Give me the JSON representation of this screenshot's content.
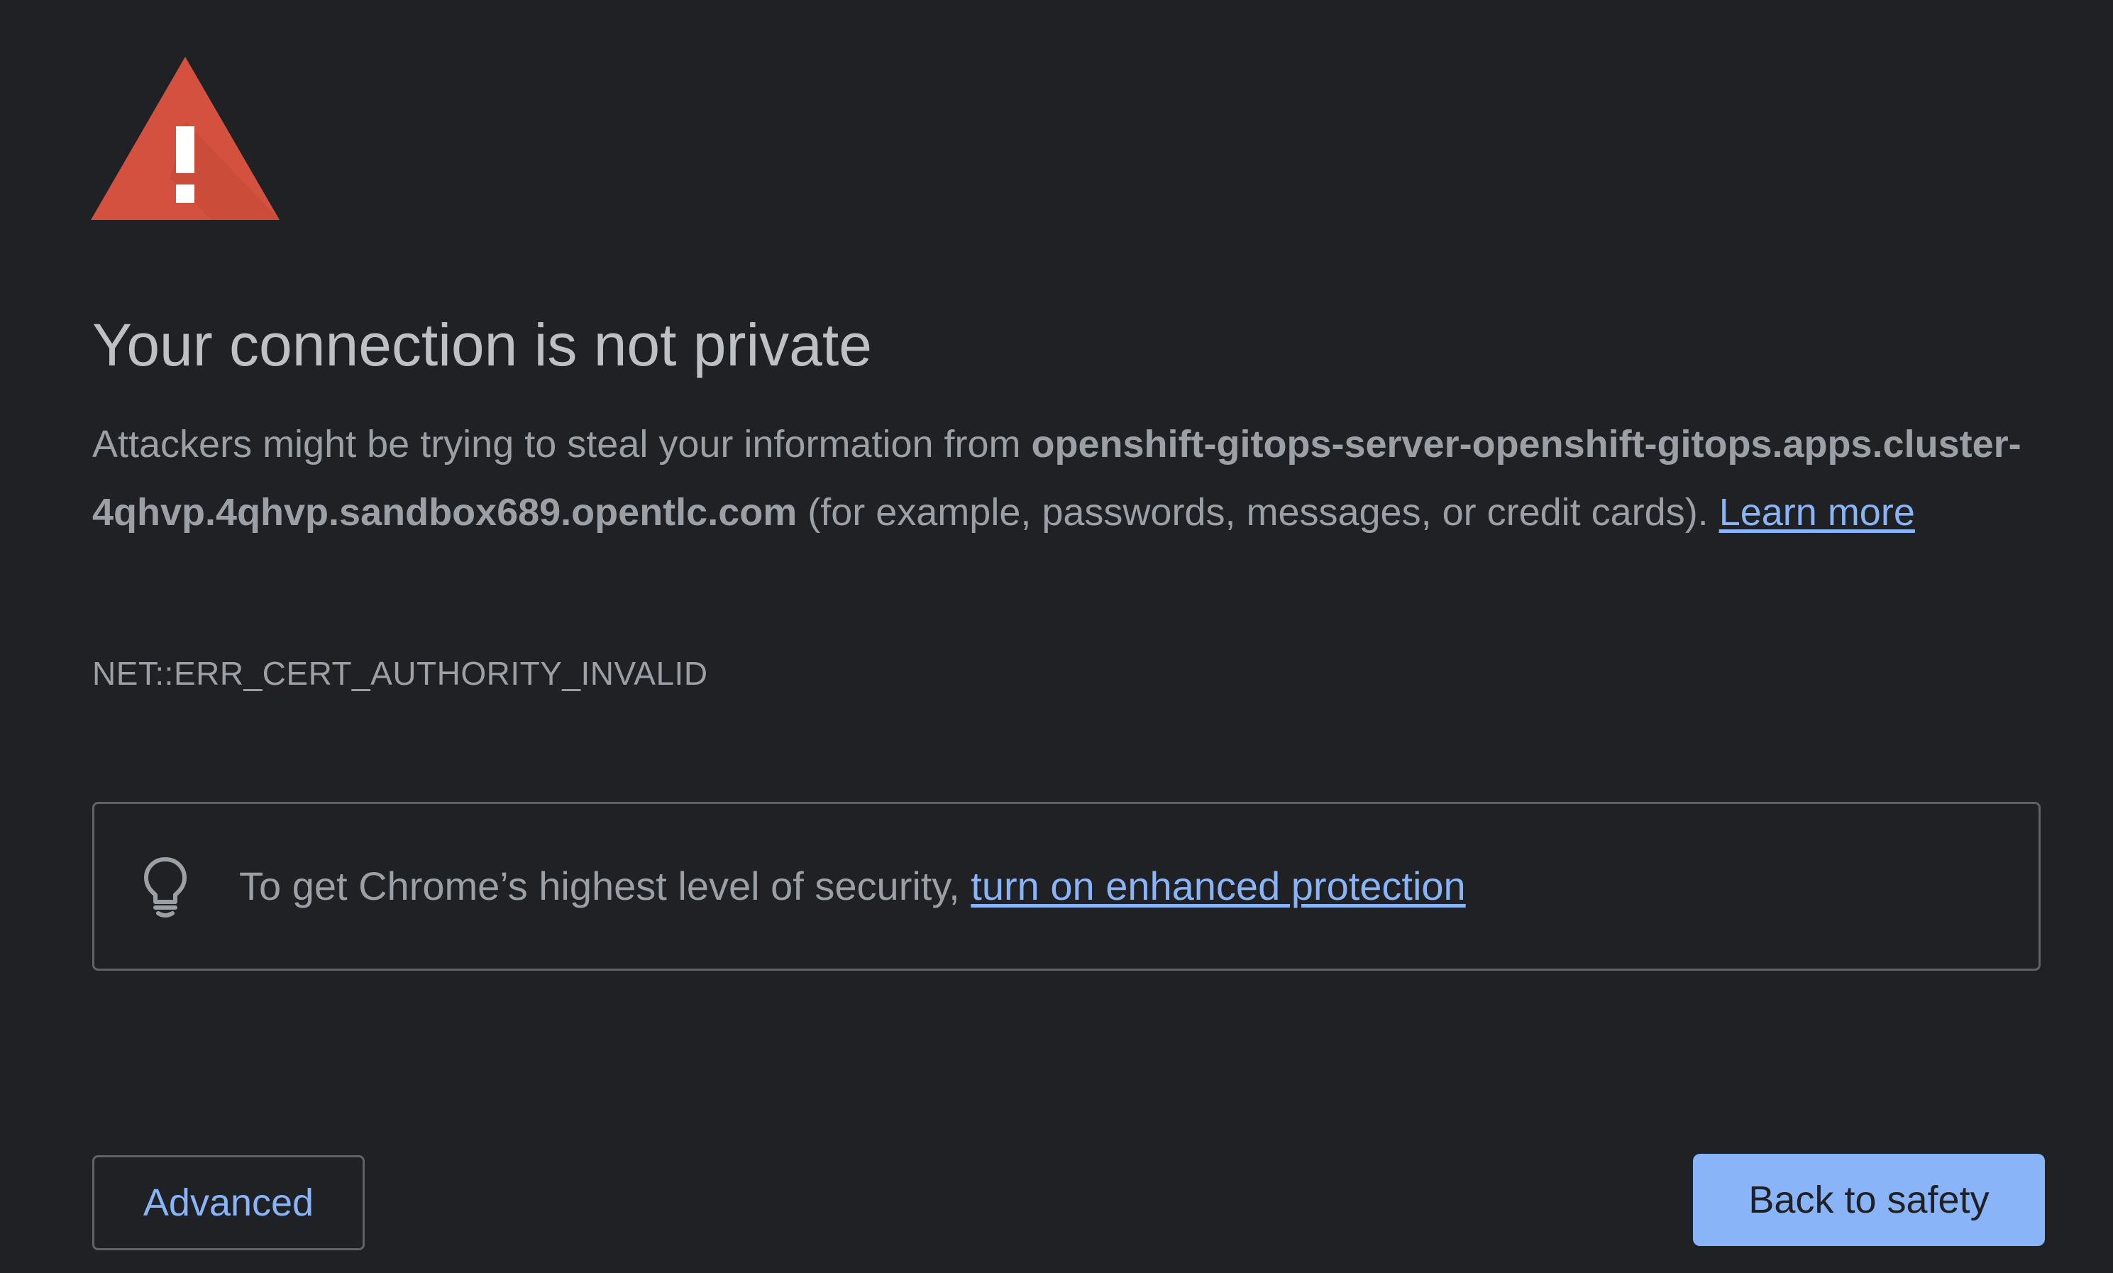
{
  "page": {
    "icon": "warning-triangle-icon",
    "title": "Your connection is not private",
    "body_prefix": "Attackers might be trying to steal your information from ",
    "host": "openshift-gitops-server-openshift-gitops.apps.cluster-4qhvp.4qhvp.sandbox689.opentlc.com",
    "body_suffix": " (for example, passwords, messages, or credit cards). ",
    "learn_more": "Learn more",
    "error_code": "NET::ERR_CERT_AUTHORITY_INVALID"
  },
  "enhanced_protection": {
    "icon": "lightbulb-icon",
    "text": "To get Chrome’s highest level of security, ",
    "link": "turn on enhanced protection"
  },
  "actions": {
    "advanced": "Advanced",
    "back_to_safety": "Back to safety"
  },
  "colors": {
    "background": "#202124",
    "text": "#9aa0a6",
    "title": "#bdc1c6",
    "link": "#8ab4f8",
    "primary_button": "#8ab4f8",
    "warning_red": "#d4513f",
    "border": "#5f6368"
  }
}
